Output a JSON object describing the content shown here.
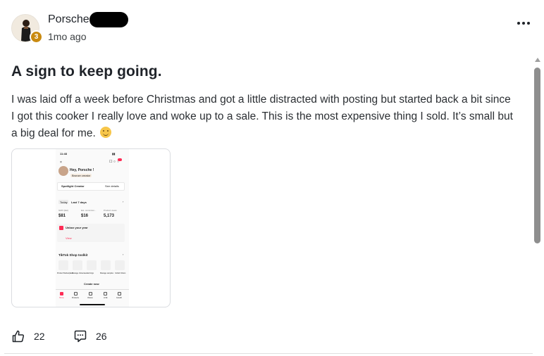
{
  "post": {
    "author": {
      "name": "Porsche",
      "level": "3",
      "time_ago": "1mo ago"
    },
    "title": "A sign to keep going.",
    "body": "I was laid off a week before Christmas and got a little distracted with posting but started back a bit since I got this cooker I really love and woke up to a sale. This is the most expensive thing I sold. It’s small but a big deal for me.",
    "reactions": {
      "likes": "22",
      "comments": "26"
    }
  },
  "attachment": {
    "status_time": "11:48",
    "greeting": "Hey, Porsche !",
    "creator_badge": "Bronze creator",
    "spotlight_label": "Spotlight Creator",
    "see_details": "See details",
    "tabs": [
      "Today",
      "Last 7 days"
    ],
    "metrics": [
      {
        "label": "GMV (Est)",
        "value": "$81"
      },
      {
        "label": "Est. commissi…",
        "value": "$16"
      },
      {
        "label": "Product views",
        "value": "5,173"
      }
    ],
    "unbox_title": "Unbox your year",
    "unbox_cta": "View",
    "toolkit_title": "TikTok Shop toolkit",
    "toolkit_items": [
      "Product Marketplace",
      "Manage showcase",
      "Earnings",
      "Manage samples",
      "Collab Orders"
    ],
    "create_label": "Create now",
    "nav_items": [
      "Home",
      "Products",
      "Videos",
      "LIVE",
      "Growth"
    ]
  },
  "colors": {
    "level_badge": "#c98a10",
    "scroll_thumb": "#8e8e8e",
    "tiktok_accent": "#fe2c55"
  }
}
